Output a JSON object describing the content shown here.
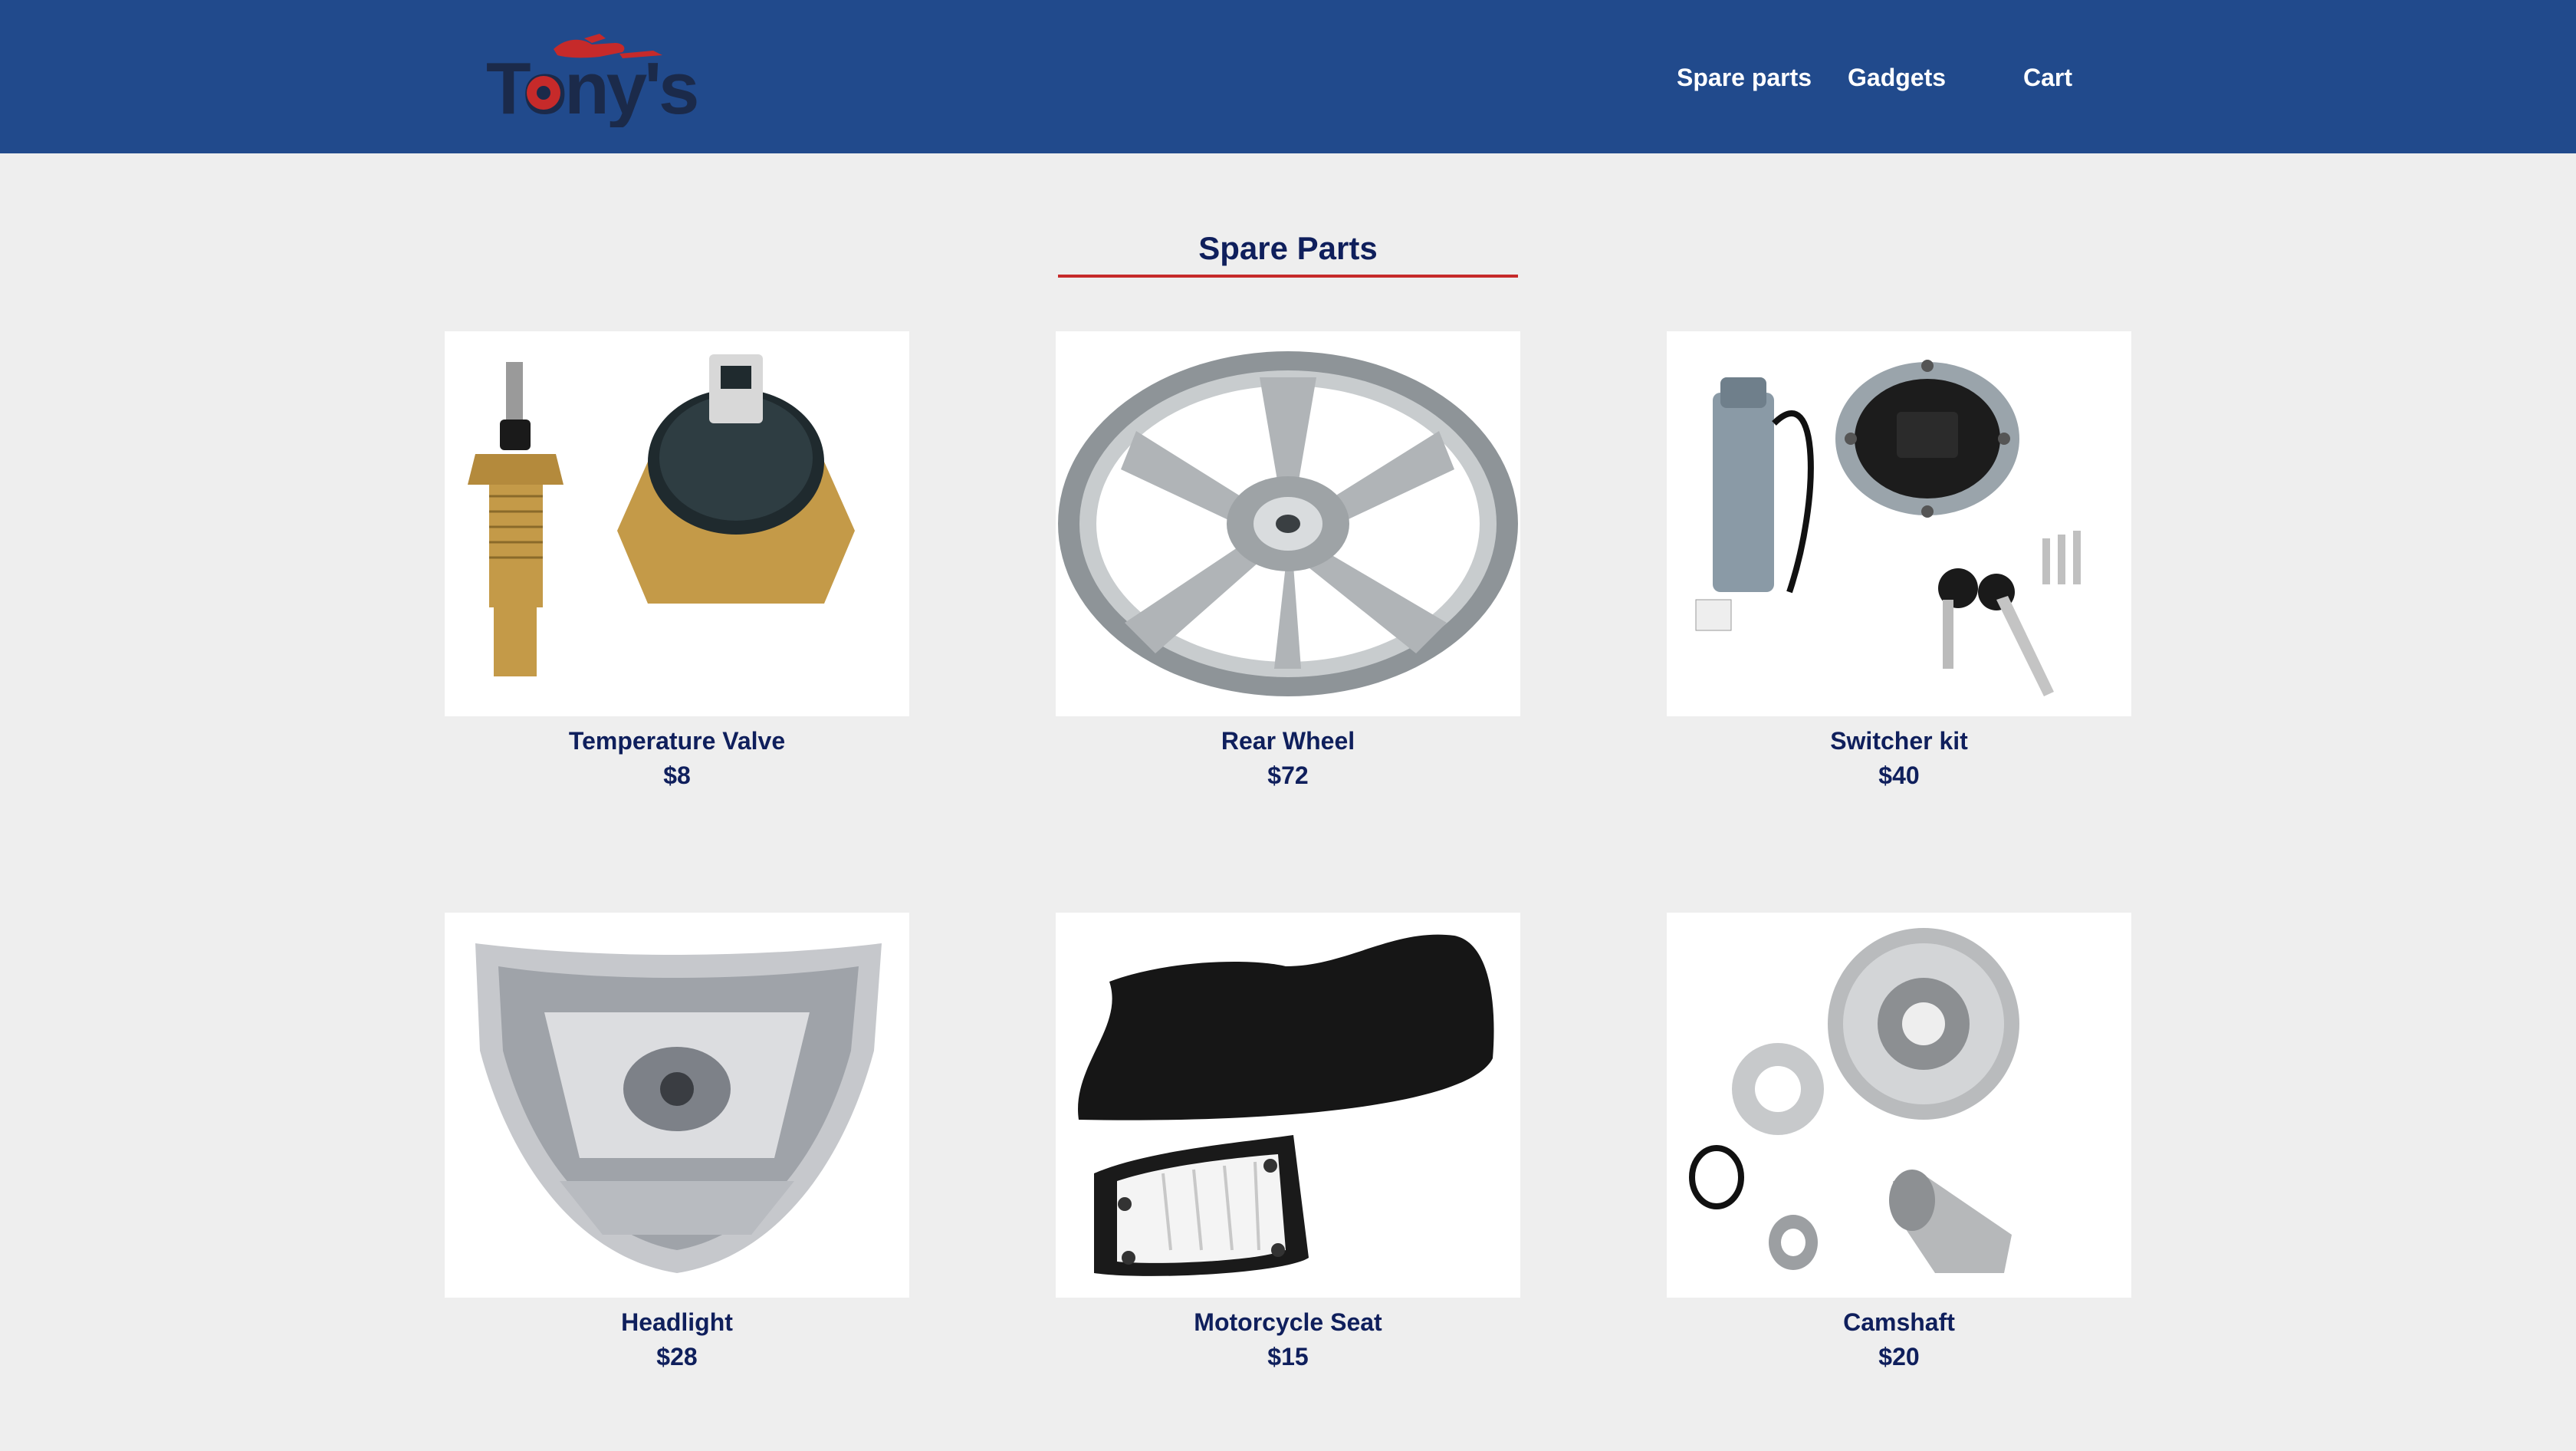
{
  "header": {
    "logo_text": "Tony's",
    "nav": [
      {
        "label": "Spare parts"
      },
      {
        "label": "Gadgets"
      },
      {
        "label": "Cart"
      }
    ]
  },
  "section": {
    "title": "Spare Parts"
  },
  "products": [
    {
      "name": "Temperature Valve",
      "price": "$8",
      "image": "temperature-valve-image"
    },
    {
      "name": "Rear Wheel",
      "price": "$72",
      "image": "rear-wheel-image"
    },
    {
      "name": "Switcher kit",
      "price": "$40",
      "image": "switcher-kit-image"
    },
    {
      "name": "Headlight",
      "price": "$28",
      "image": "headlight-image"
    },
    {
      "name": "Motorcycle Seat",
      "price": "$15",
      "image": "motorcycle-seat-image"
    },
    {
      "name": "Camshaft",
      "price": "$20",
      "image": "camshaft-image"
    }
  ],
  "colors": {
    "header_bg": "#214a8c",
    "accent_red": "#c62a2a",
    "text_navy": "#0f1f5c",
    "page_bg": "#eeeeee"
  }
}
